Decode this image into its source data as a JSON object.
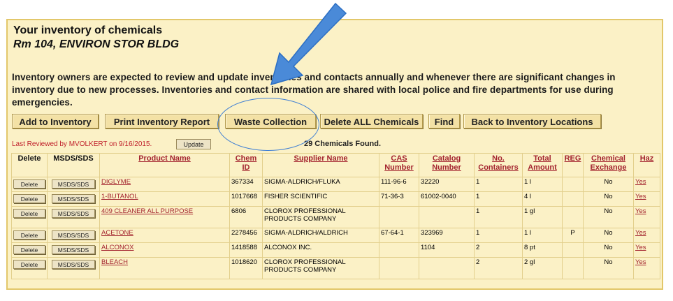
{
  "header": {
    "title": "Your inventory of chemicals",
    "location": "Rm 104, ENVIRON STOR BLDG"
  },
  "notice": "Inventory owners are expected to review and update inventories and contacts annually and whenever there are significant changes in inventory due to new processes. Inventories and contact information are shared with local police and fire departments for use during emergencies.",
  "toolbar": {
    "add": "Add to Inventory",
    "print": "Print Inventory Report",
    "waste": "Waste Collection",
    "delete_all": "Delete ALL Chemicals",
    "find": "Find",
    "back": "Back to Inventory Locations"
  },
  "status": {
    "last_reviewed": "Last Reviewed by MVOLKERT on 9/16/2015.",
    "update_label": "Update",
    "found": "29 Chemicals Found."
  },
  "table": {
    "headers": {
      "delete": "Delete",
      "msds": "MSDS/SDS",
      "product": "Product Name",
      "chem_id": "Chem ID",
      "supplier": "Supplier Name",
      "cas": "CAS Number",
      "catalog": "Catalog Number",
      "containers": "No. Containers",
      "total": "Total Amount",
      "reg": "REG",
      "exchange": "Chemical Exchange",
      "haz": "Haz"
    },
    "delete_label": "Delete",
    "msds_label": "MSDS/SDS",
    "rows": [
      {
        "product": "DIGLYME",
        "chem_id": "367334",
        "supplier": "SIGMA-ALDRICH/FLUKA",
        "cas": "111-96-6",
        "catalog": "32220",
        "containers": "1",
        "total": "1 l",
        "reg": "",
        "exchange": "No",
        "haz": "Yes"
      },
      {
        "product": "1-BUTANOL",
        "chem_id": "1017668",
        "supplier": "FISHER SCIENTIFIC",
        "cas": "71-36-3",
        "catalog": "61002-0040",
        "containers": "1",
        "total": "4 l",
        "reg": "",
        "exchange": "No",
        "haz": "Yes"
      },
      {
        "product": "409 CLEANER ALL PURPOSE",
        "chem_id": "6806",
        "supplier": "CLOROX PROFESSIONAL PRODUCTS COMPANY",
        "cas": "",
        "catalog": "",
        "containers": "1",
        "total": "1 gl",
        "reg": "",
        "exchange": "No",
        "haz": "Yes"
      },
      {
        "product": "ACETONE",
        "chem_id": "2278456",
        "supplier": "SIGMA-ALDRICH/ALDRICH",
        "cas": "67-64-1",
        "catalog": "323969",
        "containers": "1",
        "total": "1 l",
        "reg": "P",
        "exchange": "No",
        "haz": "Yes"
      },
      {
        "product": "ALCONOX",
        "chem_id": "1418588",
        "supplier": "ALCONOX INC.",
        "cas": "",
        "catalog": "1104",
        "containers": "2",
        "total": "8 pt",
        "reg": "",
        "exchange": "No",
        "haz": "Yes"
      },
      {
        "product": "BLEACH",
        "chem_id": "1018620",
        "supplier": "CLOROX PROFESSIONAL PRODUCTS COMPANY",
        "cas": "",
        "catalog": "",
        "containers": "2",
        "total": "2 gl",
        "reg": "",
        "exchange": "No",
        "haz": "Yes"
      }
    ]
  },
  "annotation": {
    "arrow_color": "#3f7fd4",
    "circle_color": "#3f7fd4"
  }
}
